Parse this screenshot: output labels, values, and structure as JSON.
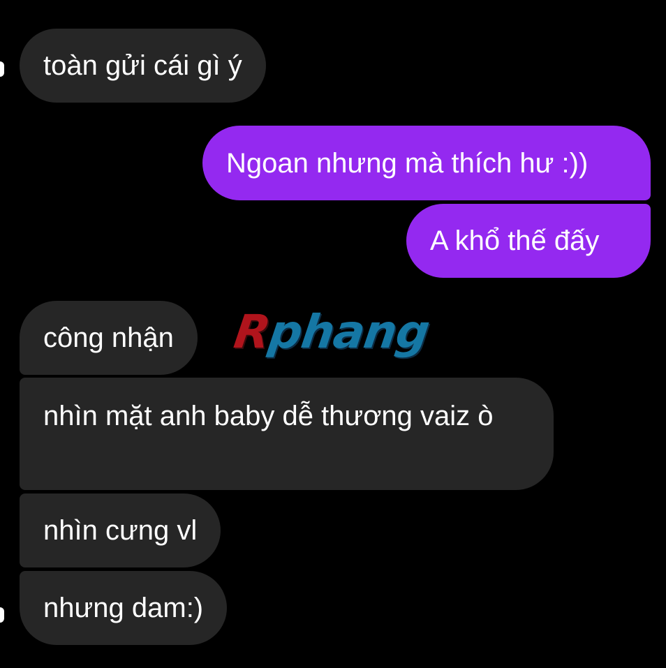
{
  "messages": [
    {
      "id": "m1",
      "direction": "incoming",
      "text": "toàn gửi cái gì ý"
    },
    {
      "id": "m2",
      "direction": "outgoing",
      "text": "Ngoan nhưng mà thích hư :))"
    },
    {
      "id": "m3",
      "direction": "outgoing",
      "text": "A khổ thế đấy"
    },
    {
      "id": "m4",
      "direction": "incoming",
      "text": "công nhận"
    },
    {
      "id": "m5",
      "direction": "incoming",
      "text": "nhìn mặt anh baby dễ thương vaiz ò"
    },
    {
      "id": "m6",
      "direction": "incoming",
      "text": "nhìn cưng vl"
    },
    {
      "id": "m7",
      "direction": "incoming",
      "text": "nhưng dam:)"
    }
  ],
  "watermark": {
    "first_letter": "R",
    "rest": "phang"
  },
  "colors": {
    "background": "#000000",
    "incoming_bubble": "#262626",
    "outgoing_bubble": "#9429f0",
    "text": "#ffffff",
    "watermark_red": "#b0141c",
    "watermark_blue": "#1577a4"
  }
}
